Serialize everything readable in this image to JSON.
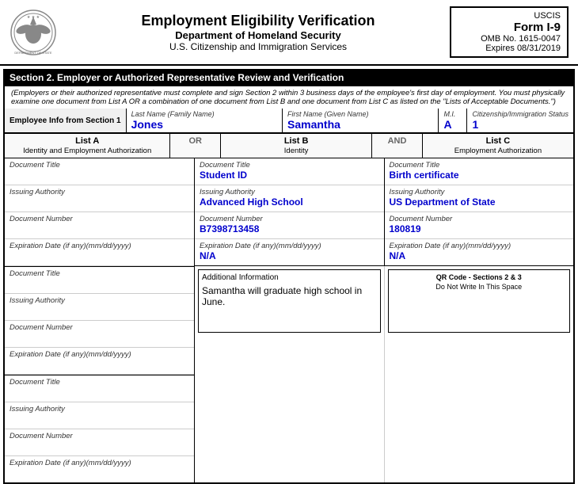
{
  "header": {
    "title": "Employment Eligibility Verification",
    "subtitle": "Department of Homeland Security",
    "sub2": "U.S. Citizenship and Immigration Services",
    "form_id": "USCIS",
    "form_title": "Form I-9",
    "omb": "OMB No. 1615-0047",
    "expires": "Expires 08/31/2019"
  },
  "section2": {
    "heading": "Section 2. Employer or Authorized Representative Review and Verification",
    "note": "(Employers or their authorized representative must complete and sign Section 2 within 3 business days of the employee's first day of employment. You must physically examine one document from List A OR a combination of one document from List B and one document from List C as listed on the \"Lists of Acceptable Documents.\")",
    "employee_label": "Employee Info from Section 1",
    "last_name_label": "Last Name (Family Name)",
    "last_name_value": "Jones",
    "first_name_label": "First Name (Given Name)",
    "first_name_value": "Samantha",
    "mi_label": "M.I.",
    "mi_value": "A",
    "citizenship_label": "Citizenship/Immigration Status",
    "citizenship_value": "1"
  },
  "lists": {
    "list_a_label": "List A",
    "list_a_sub": "Identity and Employment Authorization",
    "or_label": "OR",
    "list_b_label": "List B",
    "list_b_sub": "Identity",
    "and_label": "AND",
    "list_c_label": "List C",
    "list_c_sub": "Employment Authorization"
  },
  "list_a": {
    "doc_title_label": "Document Title",
    "doc_title_value": "",
    "issuing_auth_label": "Issuing Authority",
    "issuing_auth_value": "",
    "doc_number_label": "Document Number",
    "doc_number_value": "",
    "exp_date_label": "Expiration Date (if any)(mm/dd/yyyy)",
    "exp_date_value": "",
    "doc_title2_label": "Document Title",
    "doc_title2_value": "",
    "issuing_auth2_label": "Issuing Authority",
    "issuing_auth2_value": "",
    "doc_number2_label": "Document Number",
    "doc_number2_value": "",
    "exp_date2_label": "Expiration Date (if any)(mm/dd/yyyy)",
    "exp_date2_value": "",
    "doc_title3_label": "Document Title",
    "doc_title3_value": "",
    "issuing_auth3_label": "Issuing Authority",
    "issuing_auth3_value": "",
    "doc_number3_label": "Document Number",
    "doc_number3_value": "",
    "exp_date3_label": "Expiration Date (if any)(mm/dd/yyyy)",
    "exp_date3_value": ""
  },
  "list_b": {
    "doc_title_label": "Document Title",
    "doc_title_value": "Student ID",
    "issuing_auth_label": "Issuing Authority",
    "issuing_auth_value": "Advanced High School",
    "doc_number_label": "Document Number",
    "doc_number_value": "B7398713458",
    "exp_date_label": "Expiration Date (if any)(mm/dd/yyyy)",
    "exp_date_value": "N/A"
  },
  "list_c": {
    "doc_title_label": "Document Title",
    "doc_title_value": "Birth certificate",
    "issuing_auth_label": "Issuing Authority",
    "issuing_auth_value": "US Department of State",
    "doc_number_label": "Document Number",
    "doc_number_value": "180819",
    "exp_date_label": "Expiration Date (if any)(mm/dd/yyyy)",
    "exp_date_value": "N/A"
  },
  "additional_info": {
    "label": "Additional Information",
    "value": "Samantha will graduate high school in June."
  },
  "qr_code": {
    "line1": "QR Code - Sections 2 & 3",
    "line2": "Do Not Write In This Space"
  }
}
